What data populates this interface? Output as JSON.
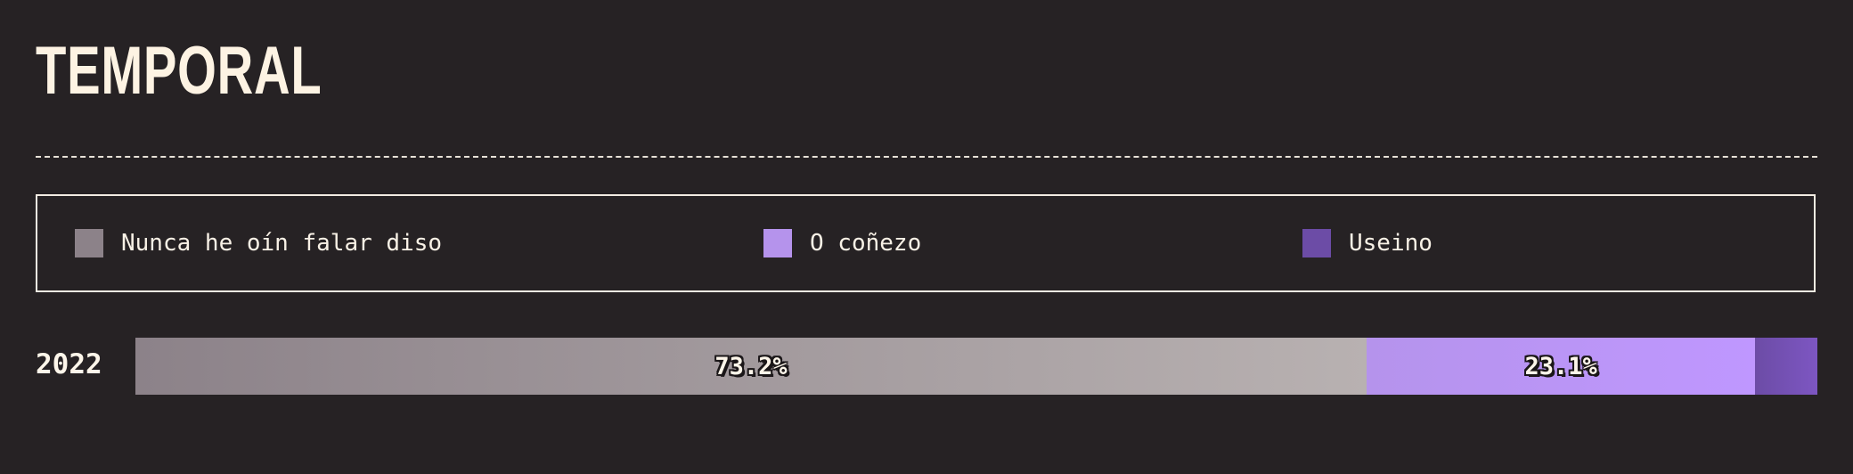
{
  "header": {
    "title": "TEMPORAL"
  },
  "legend": {
    "items": [
      {
        "label": "Nunca he oín falar diso",
        "color": "#8c8289"
      },
      {
        "label": "O coñezo",
        "color": "#b593ec"
      },
      {
        "label": "Useino",
        "color": "#6c4ca6"
      }
    ]
  },
  "colors": {
    "background": "#262224",
    "text": "#fdf6ea",
    "segment_gradients": [
      [
        "#8c8289",
        "#b8b1b1"
      ],
      [
        "#b593ec",
        "#bf97ff"
      ],
      [
        "#6c4ca6",
        "#7d56c2"
      ]
    ]
  },
  "chart_data": {
    "type": "bar",
    "orientation": "horizontal",
    "stacked": true,
    "normalized": true,
    "categories": [
      "2022"
    ],
    "series": [
      {
        "name": "Nunca he oín falar diso",
        "values": [
          73.2
        ],
        "label": "73.2%"
      },
      {
        "name": "O coñezo",
        "values": [
          23.1
        ],
        "label": "23.1%"
      },
      {
        "name": "Useino",
        "values": [
          3.7
        ],
        "label": ""
      }
    ],
    "title": "TEMPORAL",
    "xlim": [
      0,
      100
    ],
    "grid": false,
    "legend_placement": "top"
  }
}
